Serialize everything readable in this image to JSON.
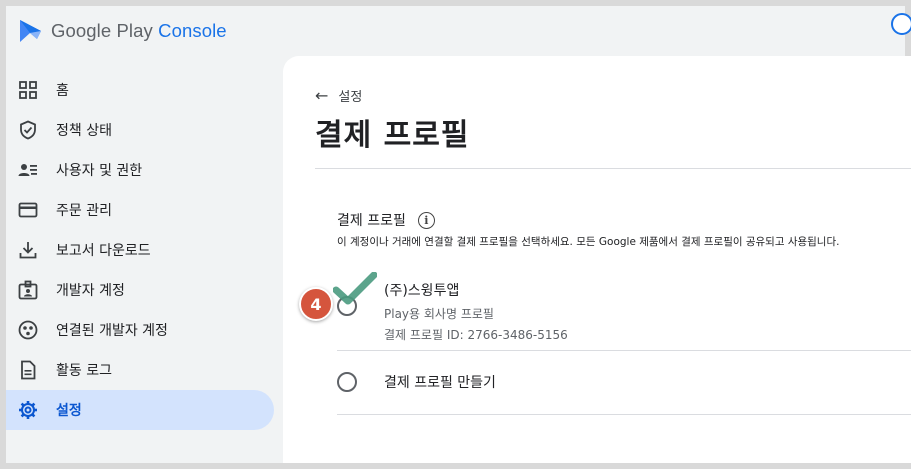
{
  "header": {
    "logo_text_main": "Google Play ",
    "logo_text_accent": "Console",
    "brand_color": "#1a73e8"
  },
  "sidebar": {
    "items": [
      {
        "label": "홈",
        "icon": "grid-icon"
      },
      {
        "label": "정책 상태",
        "icon": "shield-check-icon"
      },
      {
        "label": "사용자 및 권한",
        "icon": "users-list-icon"
      },
      {
        "label": "주문 관리",
        "icon": "credit-card-icon"
      },
      {
        "label": "보고서 다운로드",
        "icon": "download-icon"
      },
      {
        "label": "개발자 계정",
        "icon": "badge-icon"
      },
      {
        "label": "연결된 개발자 계정",
        "icon": "linked-circle-icon"
      },
      {
        "label": "활동 로그",
        "icon": "document-icon"
      },
      {
        "label": "설정",
        "icon": "gear-icon",
        "active": true
      }
    ],
    "active_color": "#d3e3fd"
  },
  "main": {
    "breadcrumb_label": "설정",
    "title": "결제 프로필",
    "section": {
      "title": "결제 프로필",
      "description": "이 계정이나 거래에 연결할 결제 프로필을 선택하세요. 모든 Google 제품에서 결제 프로필이 공유되고 사용됩니다."
    },
    "options": [
      {
        "name": "(주)스윙투앱",
        "subtitle": "Play용 회사명 프로필",
        "profile_id": "결제 프로필 ID: 2766-3486-5156"
      },
      {
        "name": "결제 프로필 만들기"
      }
    ]
  },
  "annotation": {
    "step_number": "4",
    "badge_color": "#d5553d",
    "check_color": "#4a9a7f"
  }
}
